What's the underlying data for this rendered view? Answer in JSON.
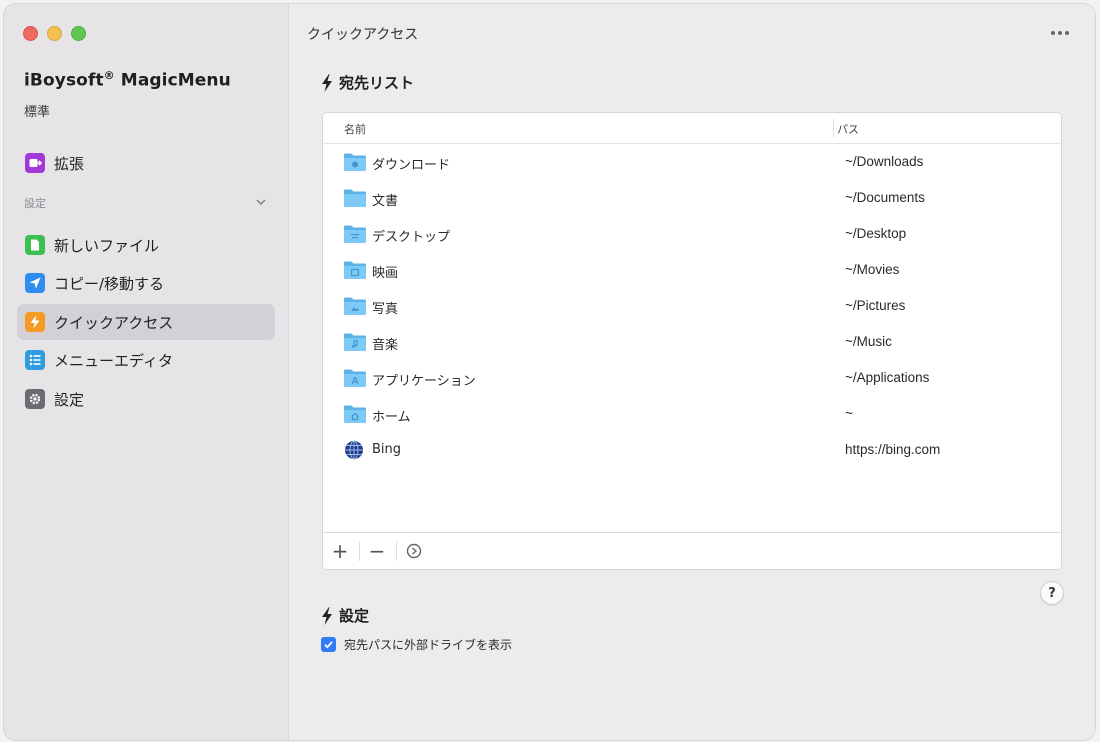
{
  "app": {
    "name": "iBoysoft",
    "name_mark": "®",
    "name_suffix": " MagicMenu",
    "edition": "標準"
  },
  "sidebar": {
    "top_item": {
      "label": "拡張",
      "icon": "extension-icon",
      "color": "#a13ad6"
    },
    "section_label": "設定",
    "items": [
      {
        "label": "新しいファイル",
        "icon": "new-file-icon",
        "color": "#3bbf4e"
      },
      {
        "label": "コピー/移動する",
        "icon": "send-arrow-icon",
        "color": "#2f8cf0"
      },
      {
        "label": "クイックアクセス",
        "icon": "lightning-icon",
        "color": "#f59a23",
        "selected": true
      },
      {
        "label": "メニューエディタ",
        "icon": "list-icon",
        "color": "#2f9be0"
      },
      {
        "label": "設定",
        "icon": "gear-icon",
        "color": "#6b6b70"
      }
    ]
  },
  "main": {
    "title": "クイックアクセス",
    "destination_section": "宛先リスト",
    "table": {
      "columns": [
        "名前",
        "パス"
      ],
      "rows": [
        {
          "name": "ダウンロード",
          "path": "~/Downloads",
          "icon": "downloads-folder-icon"
        },
        {
          "name": "文書",
          "path": "~/Documents",
          "icon": "documents-folder-icon"
        },
        {
          "name": "デスクトップ",
          "path": "~/Desktop",
          "icon": "desktop-folder-icon"
        },
        {
          "name": "映画",
          "path": "~/Movies",
          "icon": "movies-folder-icon"
        },
        {
          "name": "写真",
          "path": "~/Pictures",
          "icon": "pictures-folder-icon"
        },
        {
          "name": "音楽",
          "path": "~/Music",
          "icon": "music-folder-icon"
        },
        {
          "name": "アプリケーション",
          "path": "~/Applications",
          "icon": "applications-folder-icon"
        },
        {
          "name": "ホーム",
          "path": "~",
          "icon": "home-folder-icon"
        },
        {
          "name": "Bing",
          "path": "https://bing.com",
          "icon": "globe-icon"
        }
      ],
      "toolbar": {
        "add": "+",
        "remove": "−"
      }
    },
    "help_label": "?",
    "settings_section": "設定",
    "checkbox": {
      "label": "宛先パスに外部ドライブを表示",
      "checked": true
    }
  }
}
